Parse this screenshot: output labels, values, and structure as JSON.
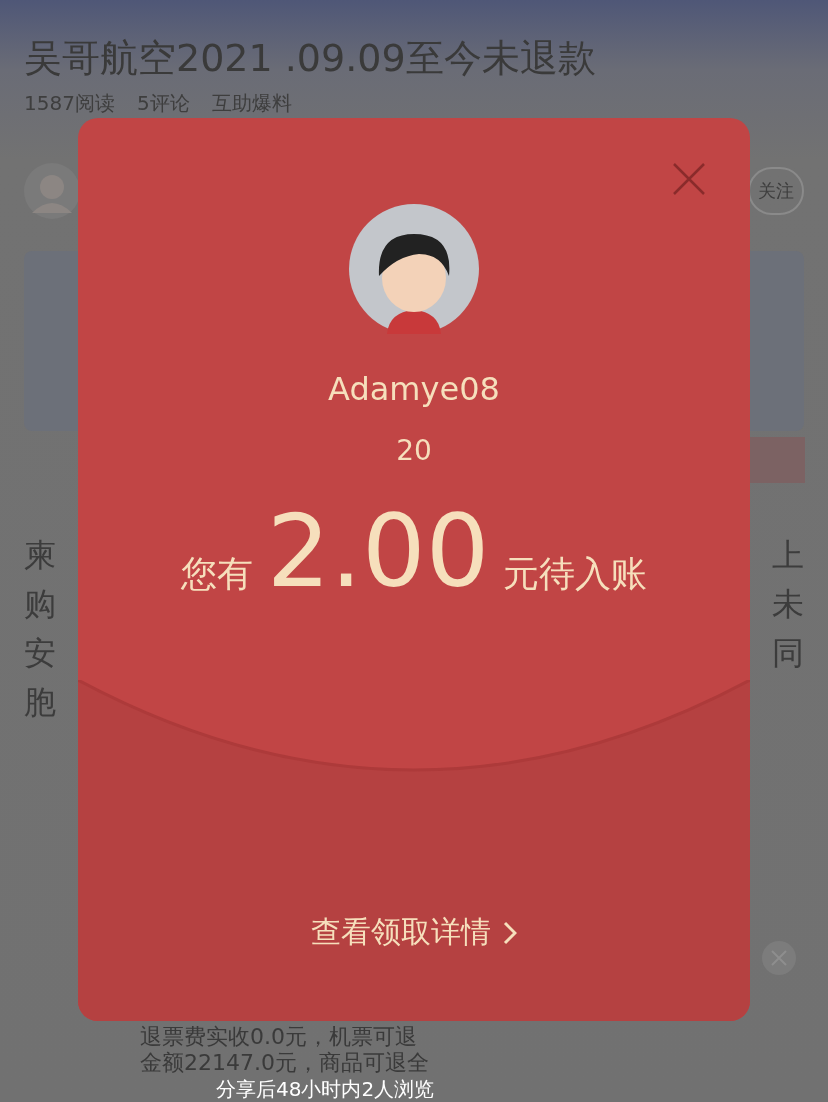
{
  "article": {
    "title": "吴哥航空2021 .09.09至今未退款",
    "meta": [
      "1587阅读",
      "5评论",
      "互助爆料"
    ],
    "follow_button": "关注",
    "body_left": [
      "柬",
      "购",
      "安",
      "胞"
    ],
    "body_right": [
      "上",
      "未",
      "同"
    ],
    "footer_lines": [
      "退票费实收0.0元，机票可退",
      "金额22147.0元，商品可退全"
    ]
  },
  "share_banner": "分享后48小时内2人浏览",
  "red_packet": {
    "sender": "Adamye08",
    "count": "20",
    "prefix": "您有",
    "amount": "2.00",
    "suffix": "元待入账",
    "details_link": "查看领取详情"
  }
}
